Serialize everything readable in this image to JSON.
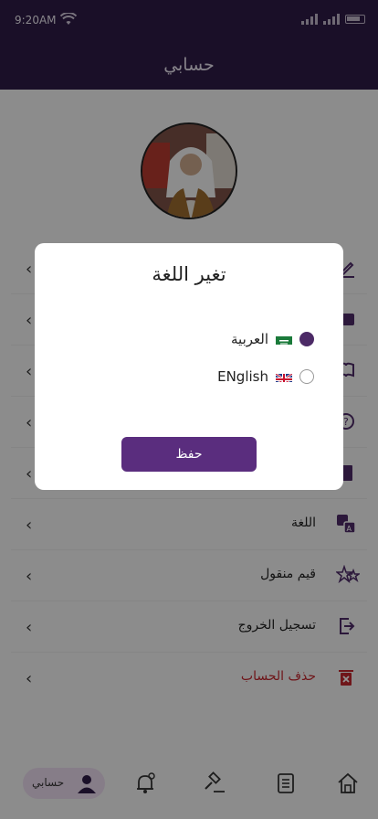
{
  "status_bar": {
    "time": "9:20AM"
  },
  "header": {
    "title": "حسابي"
  },
  "menu": {
    "items": [
      {
        "label": "",
        "icon": "edit-icon"
      },
      {
        "label": "",
        "icon": "card-icon"
      },
      {
        "label": "",
        "icon": "book-icon"
      },
      {
        "label": "",
        "icon": "help-icon"
      },
      {
        "label": "",
        "icon": "document-icon"
      },
      {
        "label": "اللغة",
        "icon": "translate-icon"
      },
      {
        "label": "قيم منقول",
        "icon": "stars-icon"
      },
      {
        "label": "تسجيل الخروج",
        "icon": "logout-icon"
      },
      {
        "label": "حذف الحساب",
        "icon": "trash-icon"
      }
    ]
  },
  "bottom_nav": {
    "active_label": "حسابي",
    "items": [
      "home-icon",
      "list-icon",
      "gavel-icon",
      "bell-icon",
      "user-icon"
    ]
  },
  "dialog": {
    "title": "تغير اللغة",
    "options": [
      {
        "label": "العربية",
        "flag": "saudi-flag-icon",
        "selected": true
      },
      {
        "label": "ENglish",
        "flag": "uk-flag-icon",
        "selected": false
      }
    ],
    "save_label": "حفظ"
  },
  "colors": {
    "primary": "#4c2a66",
    "header": "#2e1a45",
    "danger": "#c0262d"
  }
}
